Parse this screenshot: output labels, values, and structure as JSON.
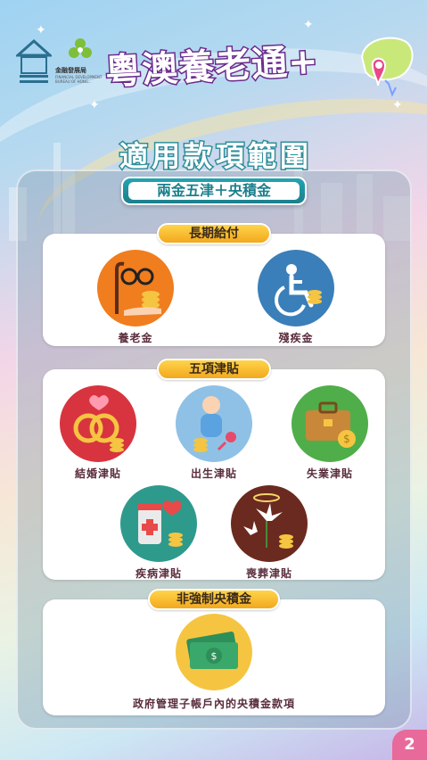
{
  "header": {
    "org_name": "金融發展局",
    "org_en": "FINANCIAL DEVELOPMENT BUREAU OF HONG...",
    "title": "粵澳養老通+"
  },
  "section": {
    "title": "適用款項範圍",
    "subtitle": "兩金五津＋央積金"
  },
  "groups": {
    "long_term": {
      "label": "長期給付",
      "items": [
        "養老金",
        "殘疾金"
      ]
    },
    "allowances": {
      "label": "五項津貼",
      "items": [
        "結婚津貼",
        "出生津貼",
        "失業津貼",
        "疾病津貼",
        "喪葬津貼"
      ]
    },
    "provident": {
      "label": "非強制央積金",
      "items": [
        "政府管理子帳戶內的央積金款項"
      ]
    }
  },
  "page": {
    "number": "2"
  },
  "colors": {
    "accent_yellow": "#f2a81e",
    "teal": "#1b7f8c",
    "purple": "#6a2b8c",
    "page_badge": "#e86a9a"
  }
}
